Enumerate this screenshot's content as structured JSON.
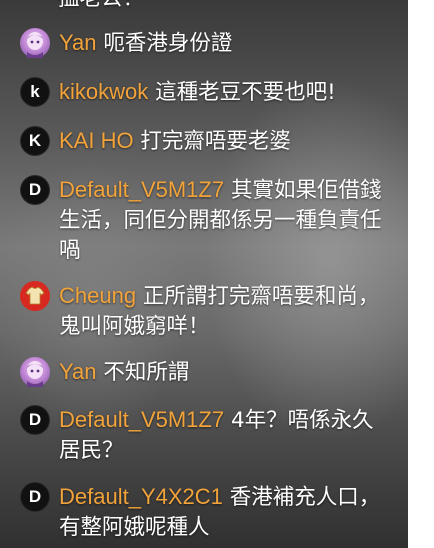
{
  "top_partial_text": "搵老公！",
  "messages": [
    {
      "username": "Yan",
      "text": "呃香港身份證",
      "avatar": "anime-avatar",
      "avatar_letter": ""
    },
    {
      "username": "kikokwok",
      "text": "這種老豆不要也吧!",
      "avatar": "letter-avatar",
      "avatar_letter": "k"
    },
    {
      "username": "KAI HO",
      "text": "打完齋唔要老婆",
      "avatar": "letter-avatar",
      "avatar_letter": "K"
    },
    {
      "username": "Default_V5M1Z7",
      "text": "其實如果佢借錢生活，同佢分開都係另一種負責任喎",
      "avatar": "letter-avatar",
      "avatar_letter": "D"
    },
    {
      "username": "Cheung",
      "text": "正所謂打完齋唔要和尚，鬼叫阿娥窮咩！",
      "avatar": "shirt-avatar",
      "avatar_letter": ""
    },
    {
      "username": "Yan",
      "text": "不知所謂",
      "avatar": "anime-avatar",
      "avatar_letter": ""
    },
    {
      "username": "Default_V5M1Z7",
      "text": "4年？唔係永久居民？",
      "avatar": "letter-avatar",
      "avatar_letter": "D"
    },
    {
      "username": "Default_Y4X2C1",
      "text": "香港補充人口，有整阿娥呢種人",
      "avatar": "letter-avatar",
      "avatar_letter": "D"
    }
  ],
  "colors": {
    "username": "#f2a33a",
    "message_text": "#ffffff",
    "shirt_avatar": "#d7291f",
    "letter_avatar": "#111111"
  }
}
